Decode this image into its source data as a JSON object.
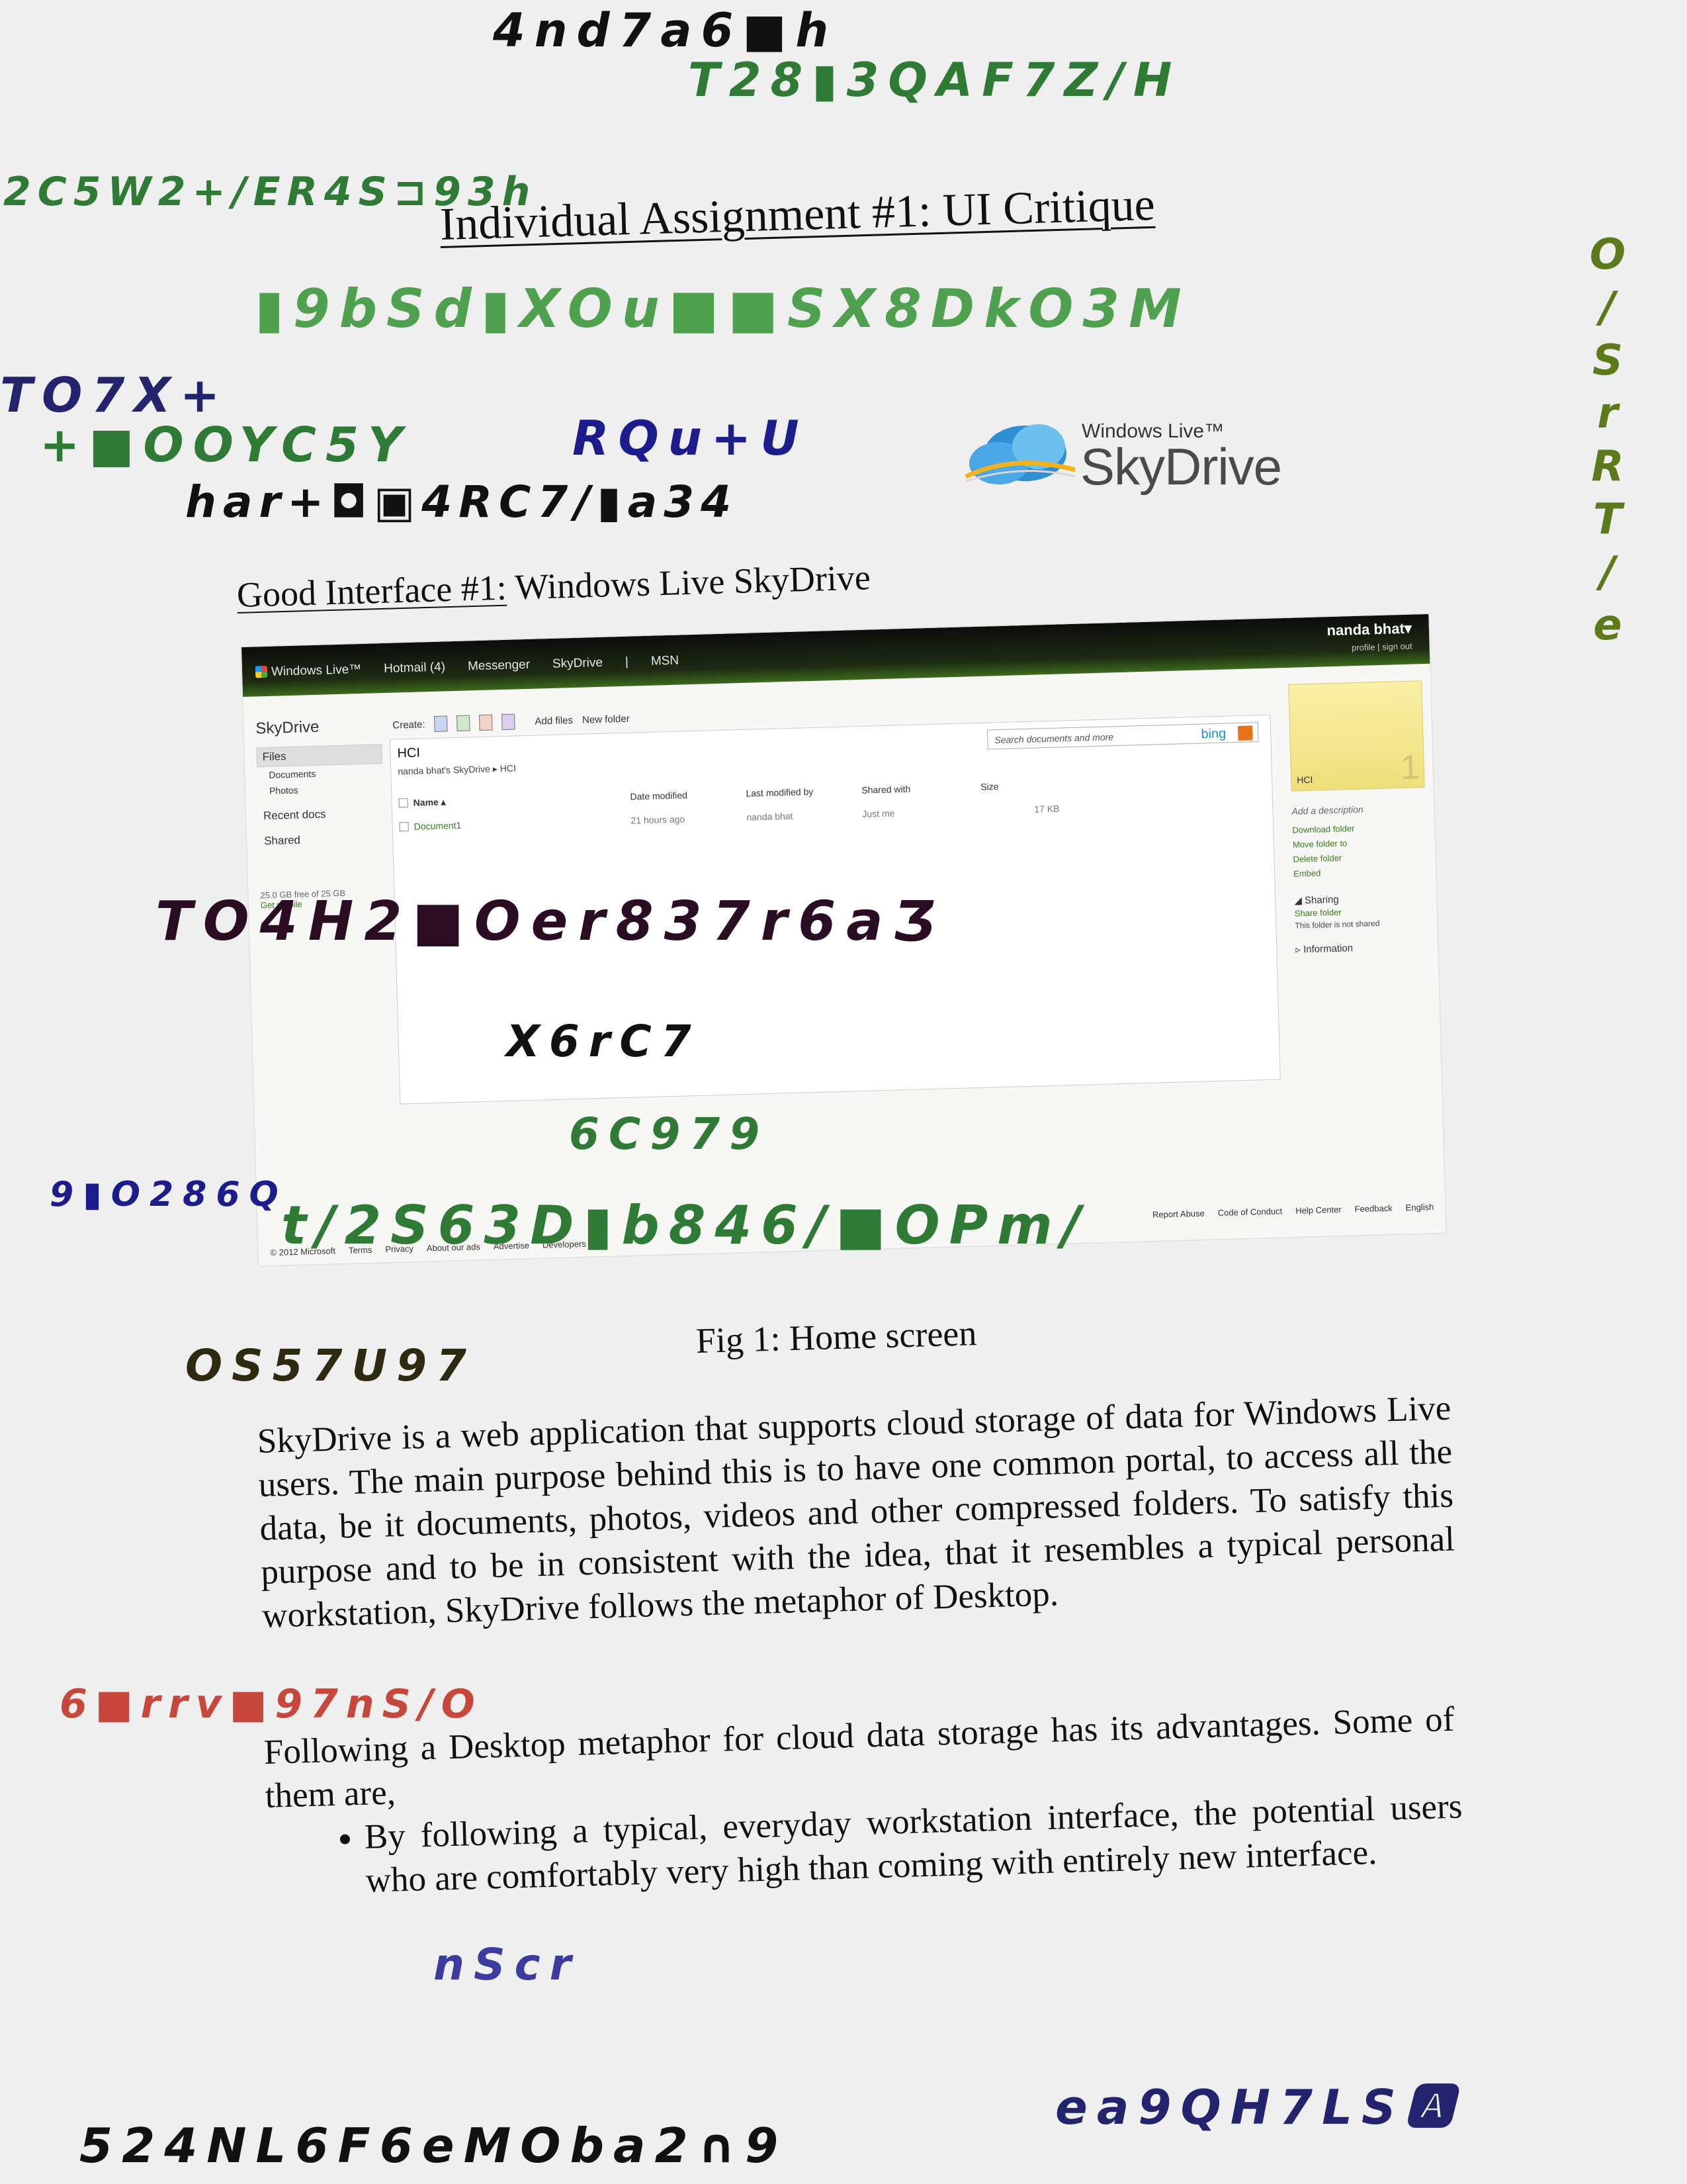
{
  "document": {
    "title": "Individual Assignment #1: UI Critique",
    "subheading_underlined": "Good Interface #1:",
    "subheading_rest": " Windows Live SkyDrive",
    "caption": "Fig 1: Home screen",
    "paragraph_1": "SkyDrive is a web application that supports cloud storage of data for Windows Live users. The main purpose behind this is to have one common portal, to access all the data, be it documents, photos, videos and other compressed folders. To satisfy this purpose and to be in consistent with the idea, that it resembles a typical personal workstation, SkyDrive follows the metaphor of Desktop.",
    "paragraph_2": "Following a Desktop metaphor for cloud data storage has its advantages. Some of them are,",
    "bullets": [
      "By following a typical, everyday workstation interface, the potential users who are comfortably very high than coming with entirely new interface."
    ]
  },
  "logo": {
    "small_text": "Windows Live™",
    "big_text": "SkyDrive"
  },
  "screenshot": {
    "topbar": {
      "brand": "Windows Live™",
      "nav": [
        "Hotmail (4)",
        "Messenger",
        "SkyDrive",
        "|",
        "MSN"
      ],
      "user": "nanda bhat▾",
      "user_links": "profile | sign out"
    },
    "leftnav": {
      "title": "SkyDrive",
      "files": "Files",
      "documents": "Documents",
      "photos": "Photos",
      "recent": "Recent docs",
      "shared": "Shared",
      "quota": "25.0 GB free of 25 GB",
      "mobile": "Get mobile"
    },
    "toolbar": {
      "create": "Create:",
      "add_files": "Add files",
      "new_folder": "New folder"
    },
    "folder_title": "HCI",
    "breadcrumb": "nanda bhat's SkyDrive  ▸  HCI",
    "search_placeholder": "Search documents and more",
    "search_brand": "bing",
    "table": {
      "headers": [
        "Name ▴",
        "Date modified",
        "Last modified by",
        "Shared with",
        "Size"
      ],
      "rows": [
        [
          "Document1",
          "21 hours ago",
          "nanda bhat",
          "Just me",
          "17 KB"
        ]
      ]
    },
    "rightpane": {
      "folder_label": "HCI",
      "folder_count": "1",
      "add_description": "Add a description",
      "links": [
        "Download folder",
        "Move folder to",
        "Delete folder",
        "Embed"
      ],
      "sharing": "◢ Sharing",
      "share_folder": "Share folder",
      "not_shared": "This folder is not shared",
      "information": "▹ Information"
    },
    "footer": {
      "left": [
        "© 2012 Microsoft",
        "Terms",
        "Privacy",
        "About our ads",
        "Advertise",
        "Developers"
      ],
      "right": [
        "Report Abuse",
        "Code of Conduct",
        "Help Center",
        "Feedback",
        "English"
      ]
    }
  },
  "handwriting": {
    "row1": "4nd7a6■h",
    "row2": "T28▮3QAF7Z/H",
    "row3": "2C5W2+/ER4S⊐93h",
    "row4": "▮9bSd▮XOu■■SX8DkO3M",
    "row5": "TO7X+",
    "row6": "+■OOYC5Y",
    "row7": "RQu+U",
    "row8": "har+◘▣4RC7/▮a34",
    "row9": "TO4H2■Oer837r6aƷ",
    "row10": "X6rC7",
    "row11": "6C979",
    "row12": "9▮O286Q",
    "row13": "t/2S63D▮b846/■OPm/",
    "row14": "OS57U97",
    "row15": "6■rrv■97nS/O",
    "row16": "nScr",
    "row17": "524NL6F6eMOba2∩9",
    "row18": "ea9QH7LS🅰",
    "vertical": "O\n/\nS\nr\nR\nT\n/\ne",
    "colors": {
      "black": "#111111",
      "green": "#2f7a34",
      "blue": "#1c1c8c",
      "navy": "#24246e",
      "olive": "#5c7a1c",
      "maroon": "#2a0d22",
      "red": "#c8473c",
      "lightgreen": "#4fa04f"
    }
  }
}
